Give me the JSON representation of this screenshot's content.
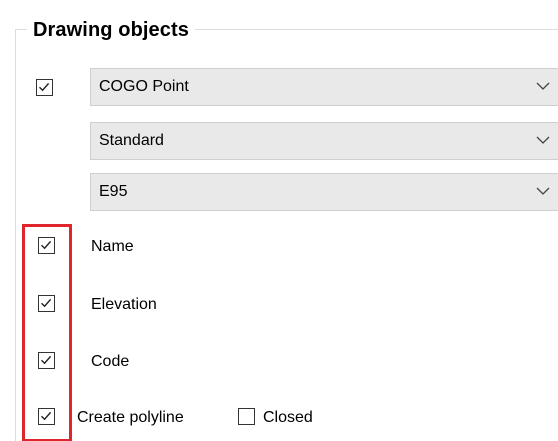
{
  "group": {
    "title": "Drawing objects"
  },
  "main_checkbox": {
    "checked": true
  },
  "dropdowns": [
    {
      "value": "COGO Point",
      "icon": "chevron-down-icon"
    },
    {
      "value": "Standard",
      "icon": "chevron-down-icon"
    },
    {
      "value": "E95",
      "icon": "chevron-down-icon"
    }
  ],
  "options": [
    {
      "label": "Name",
      "checked": true
    },
    {
      "label": "Elevation",
      "checked": true
    },
    {
      "label": "Code",
      "checked": true
    },
    {
      "label": "Create polyline",
      "checked": true
    }
  ],
  "closed_option": {
    "label": "Closed",
    "checked": false
  },
  "colors": {
    "highlight": "#e0262d",
    "combo_background": "#e9e9e9"
  }
}
